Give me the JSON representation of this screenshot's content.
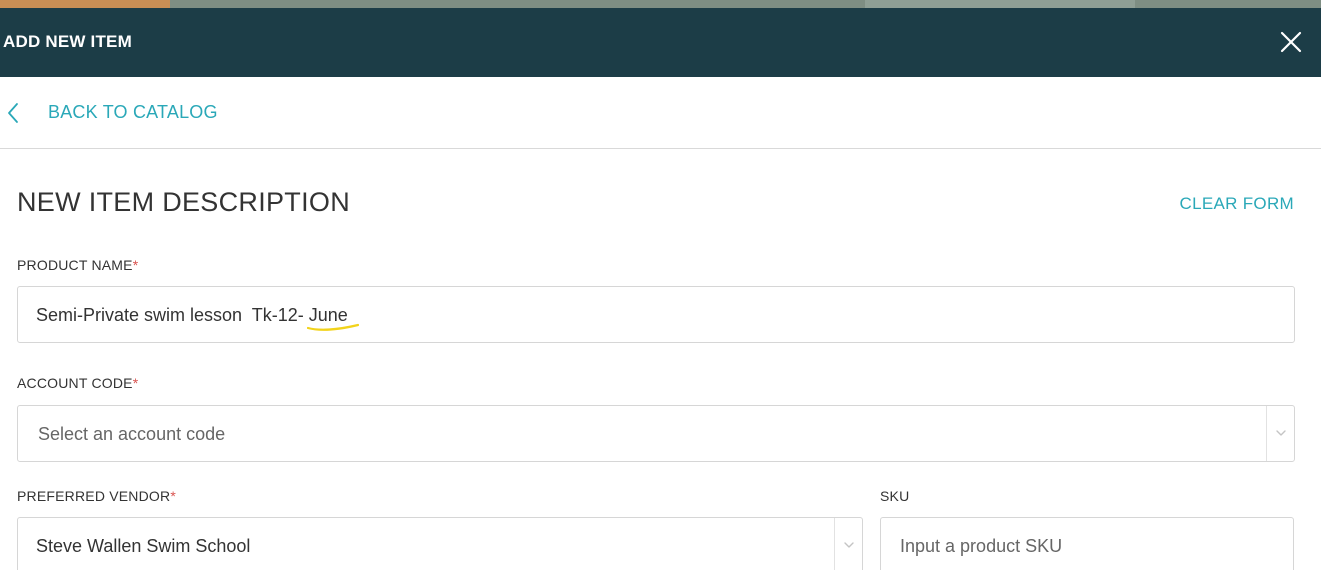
{
  "modal": {
    "title": "ADD NEW ITEM",
    "back_label": "BACK TO CATALOG"
  },
  "section": {
    "title": "NEW ITEM DESCRIPTION",
    "clear_label": "CLEAR FORM"
  },
  "fields": {
    "product_name": {
      "label": "PRODUCT NAME",
      "required_mark": "*",
      "value": "Semi-Private swim lesson  Tk-12- June"
    },
    "account_code": {
      "label": "ACCOUNT CODE",
      "required_mark": "*",
      "placeholder": "Select an account code"
    },
    "preferred_vendor": {
      "label": "PREFERRED VENDOR",
      "required_mark": "*",
      "value": "Steve Wallen Swim School"
    },
    "sku": {
      "label": "SKU",
      "placeholder": "Input a product SKU"
    }
  },
  "icons": {
    "close": "close-icon",
    "back": "chevron-left-icon",
    "dropdown": "chevron-down-icon"
  },
  "colors": {
    "header_bg": "#1c3d47",
    "accent": "#2aa8b8",
    "required": "#d9534f",
    "annotation": "#f2d31b"
  }
}
